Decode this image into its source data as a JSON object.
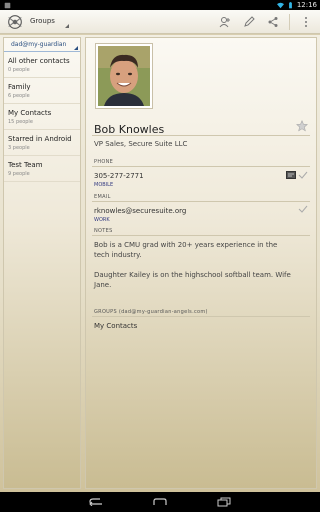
{
  "status_bar": {
    "time": "12:16",
    "icons": [
      "app-notification-icon",
      "wifi-icon",
      "battery-icon"
    ]
  },
  "action_bar": {
    "title": "Groups",
    "actions": [
      "add-contact-icon",
      "edit-icon",
      "share-icon",
      "overflow-menu-icon"
    ]
  },
  "sidebar": {
    "account": "dad@my-guardian",
    "groups": [
      {
        "name": "All other contacts",
        "count": "0 people"
      },
      {
        "name": "Family",
        "count": "6 people"
      },
      {
        "name": "My Contacts",
        "count": "15 people"
      },
      {
        "name": "Starred in Android",
        "count": "3 people"
      },
      {
        "name": "Test Team",
        "count": "9 people"
      }
    ]
  },
  "contact": {
    "name": "Bob Knowles",
    "title": "VP Sales, Secure Suite LLC",
    "phone": {
      "header": "PHONE",
      "value": "305-277-2771",
      "type": "MOBILE"
    },
    "email": {
      "header": "EMAIL",
      "value": "rknowles@securesuite.org",
      "type": "WORK"
    },
    "notes": {
      "header": "NOTES",
      "paragraph1": "Bob is a CMU grad with 20+ years experience in the tech industry.",
      "paragraph2": "Daughter Kailey is on the highschool softball team. Wife Jane."
    },
    "groups": {
      "header": "GROUPS (dad@my-guardian-angels.com)",
      "value": "My Contacts"
    }
  },
  "nav_bar": {
    "buttons": [
      "back-icon",
      "home-icon",
      "recent-apps-icon"
    ]
  }
}
